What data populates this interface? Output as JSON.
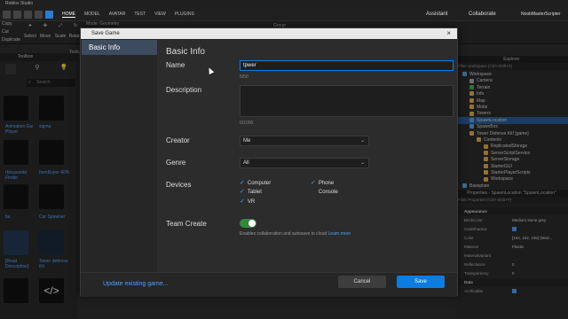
{
  "window": {
    "title": "Roblox Studio"
  },
  "ribbon": {
    "tabs": [
      "HOME",
      "MODEL",
      "AVATAR",
      "TEST",
      "VIEW",
      "PLUGINS"
    ],
    "assistant": "Assistant",
    "collaborate": "Collaborate",
    "user": "NoobMasterScripter"
  },
  "tools": {
    "select": "Select",
    "move": "Move",
    "scale": "Scale",
    "rotate": "Rotate",
    "mode": "Mode: Geometry",
    "group": "Group",
    "copy": "Copy",
    "cut": "Cut",
    "duplicate": "Duplicate",
    "tools_label": "Tools"
  },
  "toolbox": {
    "title": "Toolbox",
    "search_placeholder": "Search",
    "items": [
      {
        "label": "Animation Gui Player"
      },
      {
        "label": "sigma"
      },
      {
        "label": "rblxassetid Finder"
      },
      {
        "label": "ItemBuyer 40%"
      },
      {
        "label": "ba"
      },
      {
        "label": "Car Spawner"
      },
      {
        "label": "[Read Description]"
      },
      {
        "label": "Tower defense Kit"
      }
    ]
  },
  "explorer": {
    "title": "Explorer",
    "filter": "Filter workspace (Ctrl+Shift+X)",
    "items": [
      {
        "label": "Workspace",
        "color": "#5ba3e0"
      },
      {
        "label": "Camera",
        "color": "#aaaaaa"
      },
      {
        "label": "Terrain",
        "color": "#4caf50"
      },
      {
        "label": "Info",
        "color": "#e0b050"
      },
      {
        "label": "Map",
        "color": "#e0b050"
      },
      {
        "label": "Mobs",
        "color": "#e0b050"
      },
      {
        "label": "Towers",
        "color": "#e0b050"
      },
      {
        "label": "SpawnLocation",
        "color": "#5ba3e0"
      },
      {
        "label": "SpawnBox",
        "color": "#5ba3e0"
      },
      {
        "label": "Tower Defense Kit! [game]",
        "color": "#e0b050"
      },
      {
        "label": "Contents",
        "color": "#e0b050"
      },
      {
        "label": "ReplicatedStorage",
        "color": "#e0b050"
      },
      {
        "label": "ServerScriptService",
        "color": "#e0b050"
      },
      {
        "label": "ServerStorage",
        "color": "#e0b050"
      },
      {
        "label": "StarterGUI",
        "color": "#e0b050"
      },
      {
        "label": "StarterPlayerScripts",
        "color": "#e0b050"
      },
      {
        "label": "Workspace",
        "color": "#e0b050"
      },
      {
        "label": "Baseplate",
        "color": "#5ba3e0"
      }
    ]
  },
  "properties": {
    "title": "Properties - SpawnLocation \"SpawnLocation\"",
    "filter": "Filter Properties (Ctrl+Shift+P)",
    "sections": [
      {
        "name": "Appearance"
      },
      {
        "name": "Data"
      }
    ],
    "rows": [
      {
        "name": "BrickColor",
        "value": "Medium stone grey"
      },
      {
        "name": "CastShadow",
        "value": ""
      },
      {
        "name": "Color",
        "value": "[163, 162, 165] (Med..."
      },
      {
        "name": "Material",
        "value": "Plastic"
      },
      {
        "name": "MaterialVariant",
        "value": ""
      },
      {
        "name": "Reflectance",
        "value": "0"
      },
      {
        "name": "Transparency",
        "value": "0"
      },
      {
        "name": "Archivable",
        "value": ""
      }
    ]
  },
  "dialog": {
    "title": "Save Game",
    "sidebar_item": "Basic Info",
    "heading": "Basic Info",
    "name_label": "Name",
    "name_value": "tpwer",
    "name_counter": "5/50",
    "description_label": "Description",
    "description_counter": "0/1000",
    "creator_label": "Creator",
    "creator_value": "Me",
    "genre_label": "Genre",
    "genre_value": "All",
    "devices_label": "Devices",
    "devices": [
      {
        "label": "Computer",
        "checked": true
      },
      {
        "label": "Phone",
        "checked": true
      },
      {
        "label": "Tablet",
        "checked": true
      },
      {
        "label": "Console",
        "checked": false
      },
      {
        "label": "VR",
        "checked": true
      }
    ],
    "team_create_label": "Team Create",
    "team_create_desc": "Enables collaboration and autosave to cloud",
    "learn_more": "Learn more",
    "update_link": "Update existing game...",
    "cancel": "Cancel",
    "save": "Save",
    "colors": {
      "accent": "#0b7de0",
      "toggle_on": "#2f8a3a",
      "sidebar_active": "#3c4b5e"
    }
  }
}
